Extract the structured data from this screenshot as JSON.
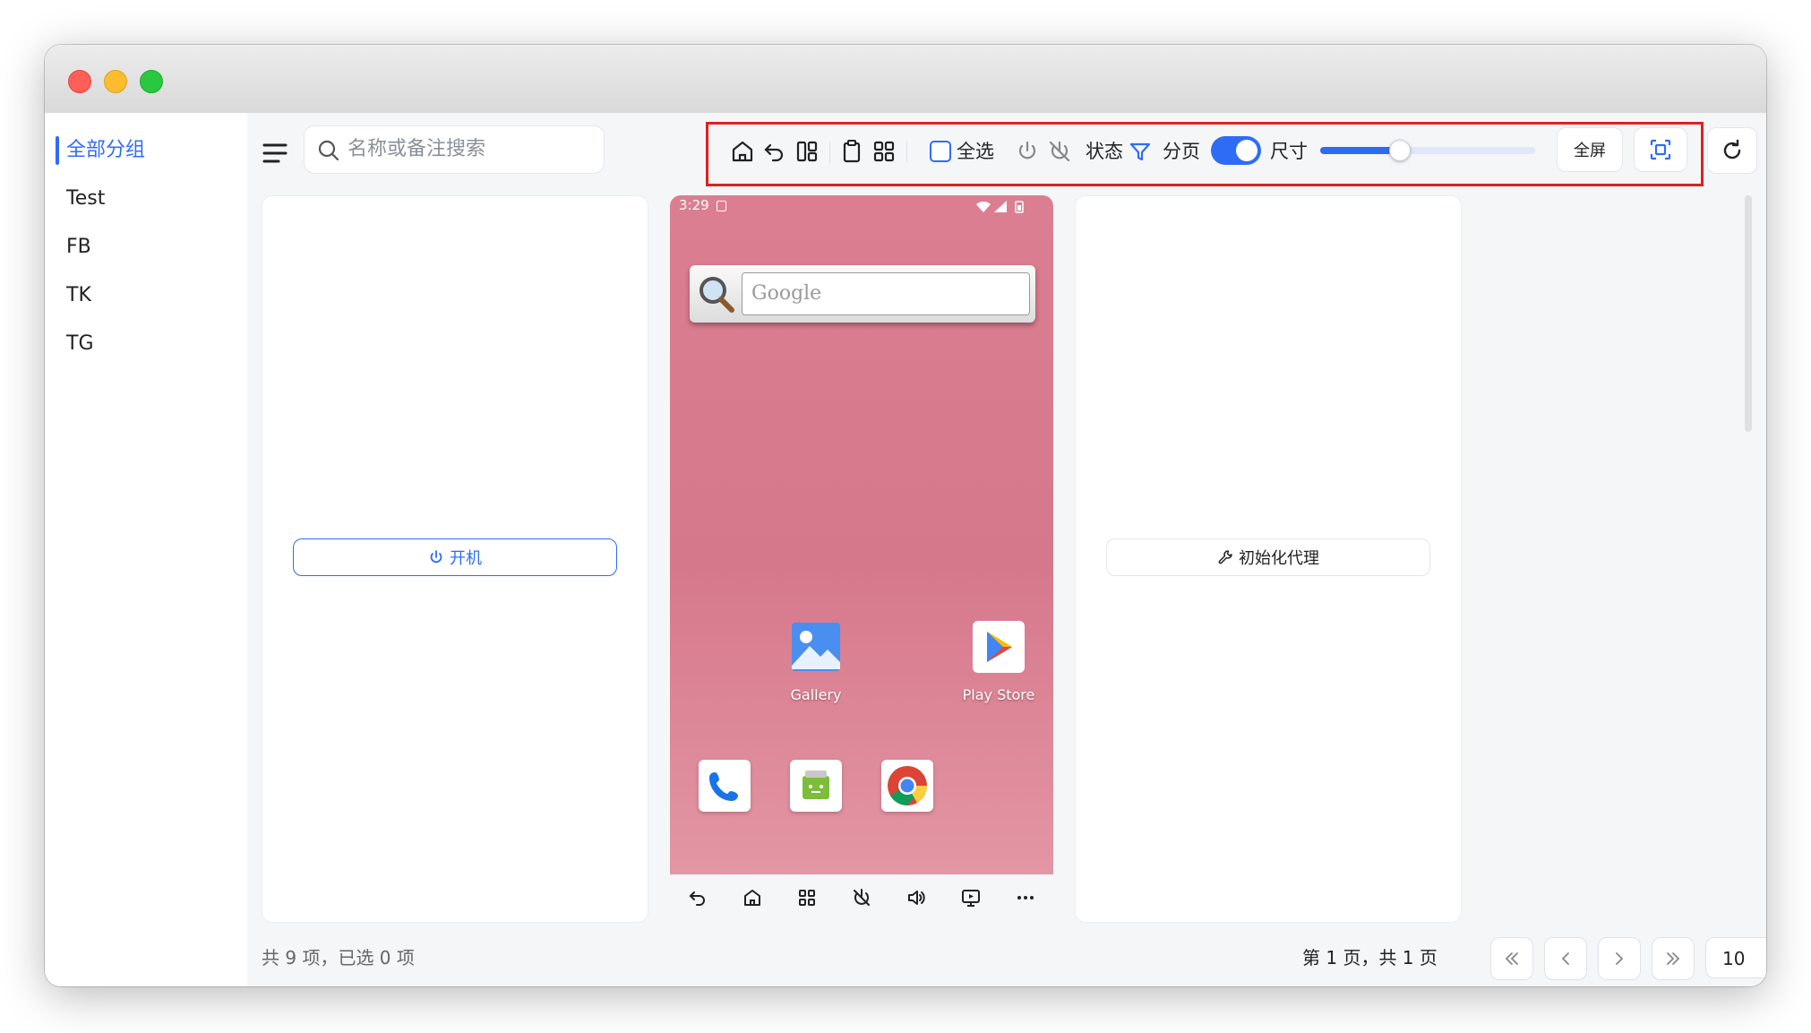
{
  "sidebar": {
    "items": [
      {
        "label": "全部分组",
        "active": true
      },
      {
        "label": "Test",
        "active": false
      },
      {
        "label": "FB",
        "active": false
      },
      {
        "label": "TK",
        "active": false
      },
      {
        "label": "TG",
        "active": false
      }
    ]
  },
  "search": {
    "placeholder": "名称或备注搜索"
  },
  "toolbar": {
    "select_all_label": "全选",
    "status_label": "状态",
    "paging_label": "分页",
    "paging_enabled": true,
    "size_label": "尺寸",
    "size_level": 0.37,
    "fullscreen_label": "全屏",
    "accent_color": "#2f6cf6",
    "highlight_color": "#e02020"
  },
  "cards": {
    "left_button_label": "开机",
    "right_button_label": "初始化代理"
  },
  "phone": {
    "status_time": "3:29",
    "search_hint": "Google",
    "apps": [
      {
        "label": "Gallery",
        "icon": "gallery-icon"
      },
      {
        "label": "Play Store",
        "icon": "play-store-icon"
      }
    ],
    "dock": [
      "phone-icon",
      "messaging-icon",
      "chrome-icon"
    ],
    "nav_icons": [
      "back-icon",
      "home-icon",
      "apps-grid-icon",
      "screen-off-icon",
      "volume-icon",
      "screenshot-icon",
      "more-icon"
    ],
    "wallpaper_color": "#d97f90"
  },
  "footer": {
    "summary": "共 9 项，已选 0 项",
    "page_info": "第 1 页，共 1 页",
    "page_size": "10"
  }
}
